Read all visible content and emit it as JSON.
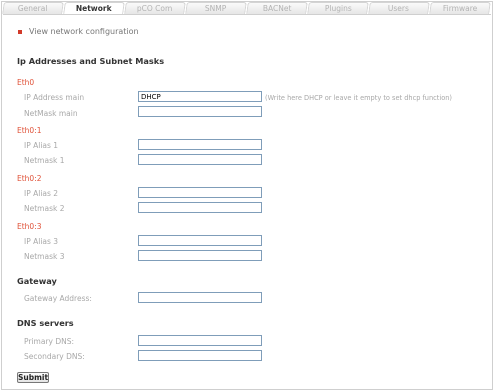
{
  "tabs": [
    "General",
    "Network",
    "pCO Com",
    "SNMP",
    "BACNet",
    "Plugins",
    "Users",
    "Firmware"
  ],
  "active_tab": "Network",
  "view_link": "View network configuration",
  "ip_section": {
    "title": "Ip Addresses and Subnet Masks",
    "eth0": {
      "title": "Eth0",
      "ip_label": "IP Address main",
      "ip_value": "DHCP",
      "ip_hint": "(Write here DHCP or leave it empty to set dhcp function)",
      "mask_label": "NetMask main",
      "mask_value": ""
    },
    "eth0_1": {
      "title": "Eth0:1",
      "ip_label": "IP Alias 1",
      "ip_value": "",
      "mask_label": "Netmask 1",
      "mask_value": ""
    },
    "eth0_2": {
      "title": "Eth0:2",
      "ip_label": "IP Alias 2",
      "ip_value": "",
      "mask_label": "Netmask 2",
      "mask_value": ""
    },
    "eth0_3": {
      "title": "Eth0:3",
      "ip_label": "IP Alias 3",
      "ip_value": "",
      "mask_label": "Netmask 3",
      "mask_value": ""
    }
  },
  "gateway": {
    "title": "Gateway",
    "label": "Gateway Address:",
    "value": ""
  },
  "dns": {
    "title": "DNS servers",
    "primary_label": "Primary DNS:",
    "primary_value": "",
    "secondary_label": "Secondary DNS:",
    "secondary_value": ""
  },
  "submit_label": "Submit",
  "colors": {
    "accent": "#e0533a",
    "bullet": "#d23a2a",
    "field_border": "#7f9db9"
  },
  "icons": {
    "view_link_bullet": "red-square-bullet-icon"
  }
}
